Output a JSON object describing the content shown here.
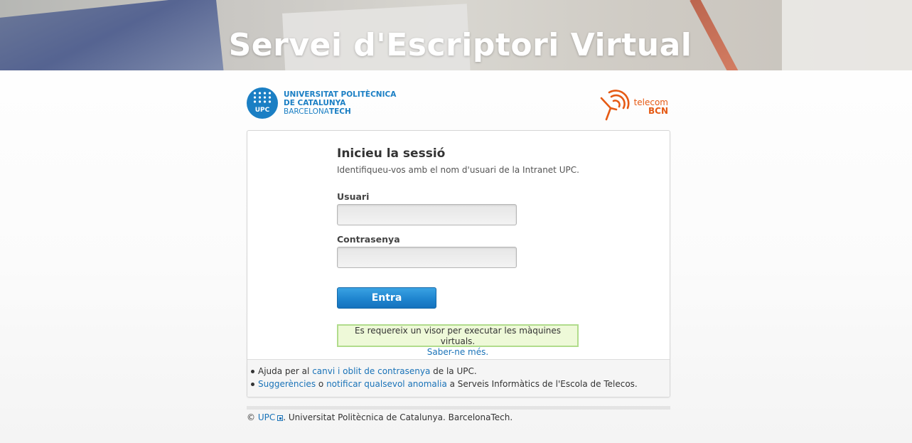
{
  "banner": {
    "title": "Servei d'Escriptori Virtual"
  },
  "logos": {
    "upc": {
      "abbr": "UPC",
      "line1": "UNIVERSITAT POLITÈCNICA",
      "line2": "DE CATALUNYA",
      "line3_a": "BARCELONA",
      "line3_b": "TECH"
    },
    "telecom": {
      "line1": "telecom",
      "line2": "BCN"
    }
  },
  "login": {
    "title": "Inicieu la sessió",
    "subtitle": "Identifiqueu-vos amb el nom d'usuari de la Intranet UPC.",
    "username_label": "Usuari",
    "username_value": "",
    "password_label": "Contrasenya",
    "password_value": "",
    "submit_label": "Entra"
  },
  "notice": {
    "text": "Es requereix un visor per executar les màquines virtuals.",
    "link": "Saber-ne més."
  },
  "help": {
    "item1": {
      "prefix": "Ajuda per al ",
      "link": "canvi i oblit de contrasenya",
      "suffix": " de la UPC."
    },
    "item2": {
      "link1": "Suggerències",
      "middle": " o ",
      "link2": "notificar qualsevol anomalia",
      "suffix": " a Serveis Informàtics de l'Escola de Telecos."
    }
  },
  "footer": {
    "copyright_symbol": "©",
    "link": "UPC",
    "text": ". Universitat Politècnica de Catalunya. BarcelonaTech."
  },
  "colors": {
    "primary_blue": "#1b7fc4",
    "link": "#1a73b8",
    "telecom_orange": "#e65a14",
    "notice_border": "#b1dc8c",
    "notice_bg": "#eef9d8"
  }
}
